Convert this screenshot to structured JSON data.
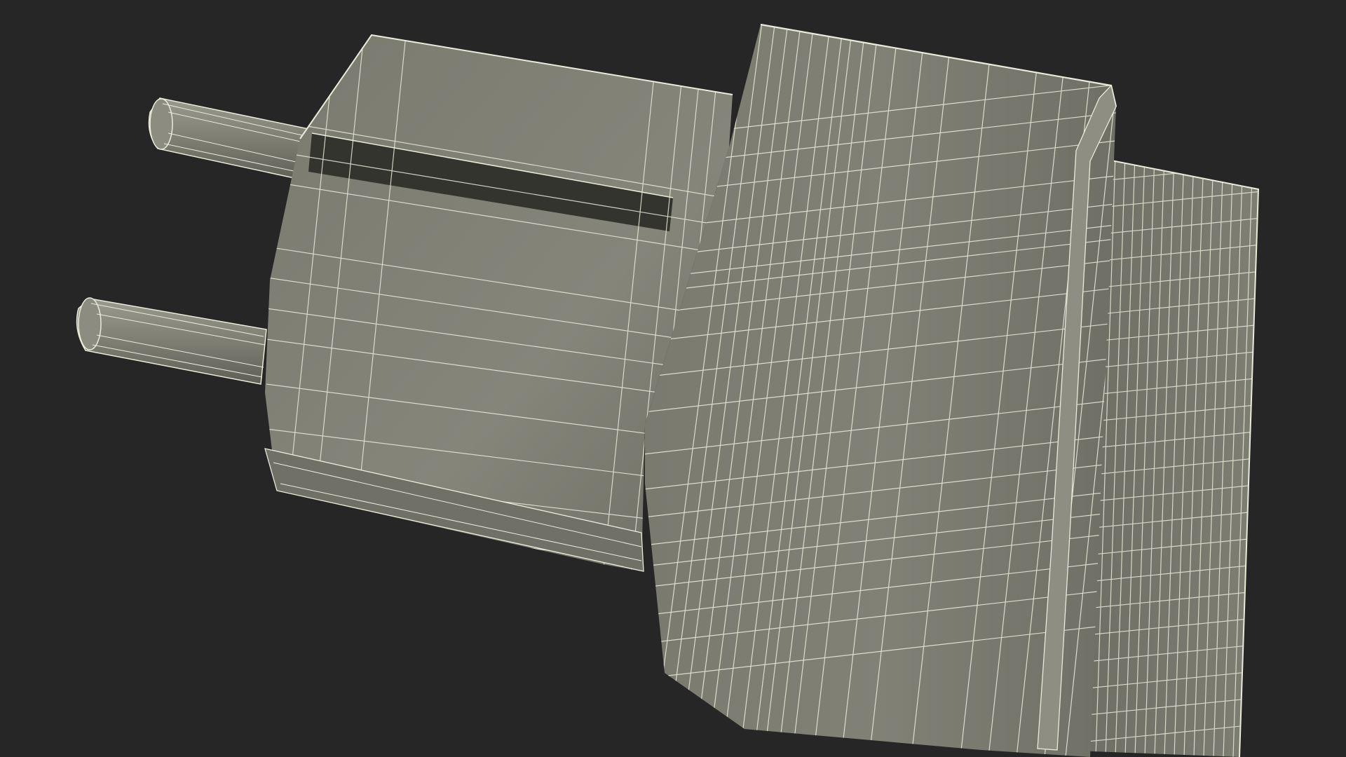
{
  "scene": {
    "background_color": "#262626",
    "subject": "wireframe-eu-plug-adapter-render",
    "colors": {
      "body_light": "#8a8a7e",
      "body_mid": "#7b7b70",
      "body_dark": "#65655b",
      "shadow": "#2a2a28",
      "wire": "#e8ecd8"
    }
  }
}
